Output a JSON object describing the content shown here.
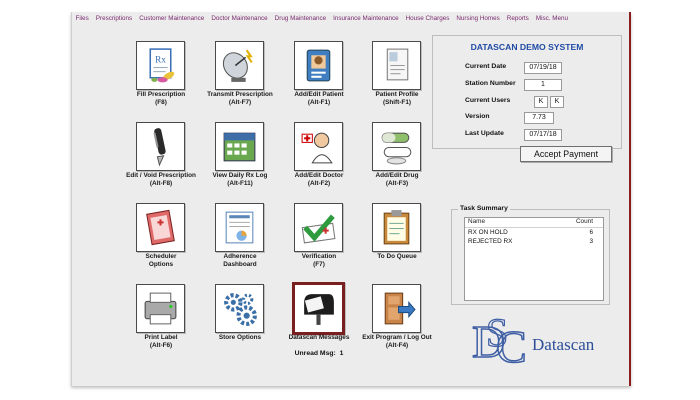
{
  "menu": [
    "Files",
    "Prescriptions",
    "Customer Maintenance",
    "Doctor Maintenance",
    "Drug Maintenance",
    "Insurance Maintenance",
    "House Charges",
    "Nursing Homes",
    "Reports",
    "Misc. Menu"
  ],
  "tiles": [
    {
      "line1": "Fill Prescription",
      "line2": "(F8)",
      "icon": "fill-prescription-icon"
    },
    {
      "line1": "Transmit Prescription",
      "line2": "(Alt-F7)",
      "icon": "satellite-dish-icon"
    },
    {
      "line1": "Add/Edit Patient",
      "line2": "(Alt-F1)",
      "icon": "patient-badge-icon"
    },
    {
      "line1": "Patient Profile",
      "line2": "(Shift-F1)",
      "icon": "patient-profile-icon"
    },
    {
      "line1": "Edit / Void Prescription",
      "line2": "(Alt-F8)",
      "icon": "pen-icon"
    },
    {
      "line1": "View Daily Rx Log",
      "line2": "(Alt-F11)",
      "icon": "calendar-icon"
    },
    {
      "line1": "Add/Edit Doctor",
      "line2": "(Alt-F2)",
      "icon": "doctor-icon"
    },
    {
      "line1": "Add/Edit Drug",
      "line2": "(Alt-F3)",
      "icon": "pills-icon"
    },
    {
      "line1": "Scheduler",
      "line2": "Options",
      "icon": "scheduler-book-icon"
    },
    {
      "line1": "Adherence",
      "line2": "Dashboard",
      "icon": "dashboard-icon"
    },
    {
      "line1": "Verification",
      "line2": "(F7)",
      "icon": "verification-icon"
    },
    {
      "line1": "To Do Queue",
      "line2": "",
      "icon": "clipboard-icon"
    },
    {
      "line1": "Print Label",
      "line2": "(Alt-F6)",
      "icon": "printer-icon"
    },
    {
      "line1": "Store Options",
      "line2": "",
      "icon": "gears-icon"
    },
    {
      "line1": "Datascan Messages",
      "line2": "",
      "icon": "mailbox-icon"
    },
    {
      "line1": "Exit Program / Log Out",
      "line2": "(Alt-F4)",
      "icon": "exit-door-icon"
    }
  ],
  "unread": {
    "label": "Unread Msg:",
    "count": "1"
  },
  "system": {
    "title": "DATASCAN DEMO SYSTEM",
    "current_date_label": "Current Date",
    "current_date": "07/19/18",
    "station_label": "Station Number",
    "station": "1",
    "users_label": "Current Users",
    "user1": "K",
    "user2": "K",
    "version_label": "Version",
    "version": "7.73",
    "last_update_label": "Last Update",
    "last_update": "07/17/18"
  },
  "accept_payment": "Accept Payment",
  "task_summary": {
    "title": "Task Summary",
    "col_name": "Name",
    "col_count": "Count",
    "rows": [
      {
        "name": "RX ON HOLD",
        "count": "6"
      },
      {
        "name": "REJECTED RX",
        "count": "3"
      }
    ]
  },
  "logo": {
    "letters": "DSC",
    "brand": "Datascan"
  },
  "colors": {
    "accent": "#1f4aa5",
    "menu_text": "#7a2a6e",
    "active_border": "#7a1f1f"
  }
}
